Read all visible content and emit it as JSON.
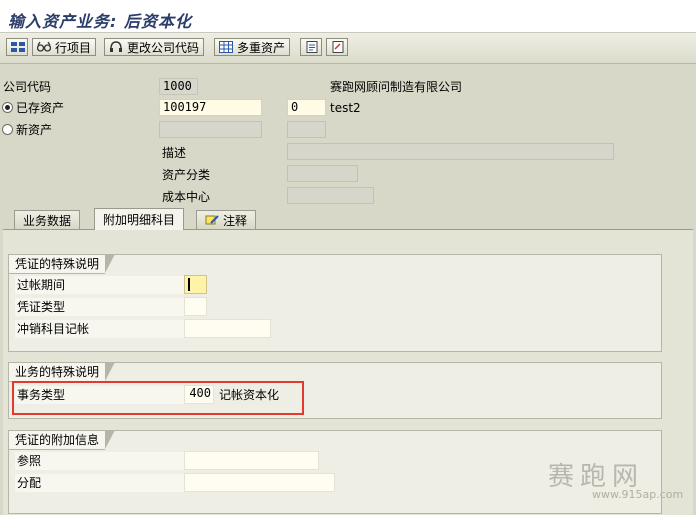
{
  "title": "输入资产业务: 后资本化",
  "toolbar": {
    "items": [
      {
        "label": ""
      },
      {
        "label": "行项目"
      },
      {
        "label": "更改公司代码"
      },
      {
        "label": "多重资产"
      },
      {
        "label": ""
      },
      {
        "label": ""
      }
    ]
  },
  "header": {
    "company_code_label": "公司代码",
    "company_code_value": "1000",
    "company_name": "赛跑网顾问制造有限公司",
    "existing_asset_label": "已存资产",
    "existing_asset_value": "100197",
    "sub_number_value": "0",
    "asset_desc_short": "test2",
    "new_asset_label": "新资产",
    "description_label": "描述",
    "asset_class_label": "资产分类",
    "cost_center_label": "成本中心"
  },
  "tabs": [
    {
      "label": "业务数据"
    },
    {
      "label": "附加明细科目"
    },
    {
      "label": "注释"
    }
  ],
  "group_doc_special": {
    "title": "凭证的特殊说明",
    "posting_period_label": "过帐期间",
    "doc_type_label": "凭证类型",
    "offset_posting_label": "冲销科目记帐"
  },
  "group_trans_special": {
    "title": "业务的特殊说明",
    "trans_type_label": "事务类型",
    "trans_type_value": "400",
    "trans_type_desc": "记帐资本化"
  },
  "group_doc_additional": {
    "title": "凭证的附加信息",
    "reference_label": "参照",
    "assignment_label": "分配"
  },
  "watermark": {
    "brand": "赛跑网",
    "url": "www.915ap.com"
  },
  "colors": {
    "highlight_border": "#e5382f",
    "title_text": "#2b3d6a"
  }
}
